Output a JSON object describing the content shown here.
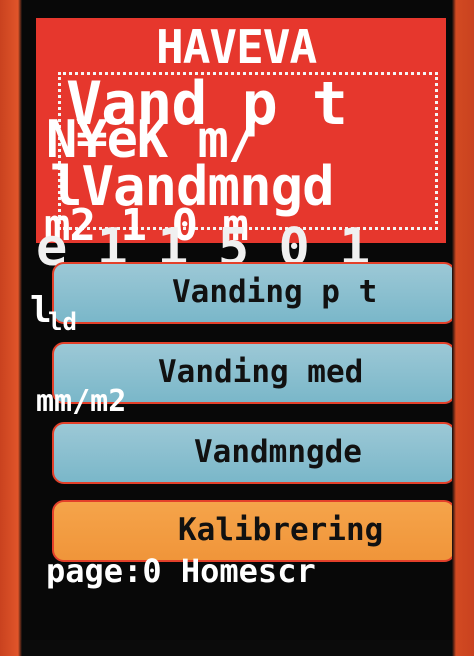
{
  "header": {
    "glitch_title": "HAVEVA",
    "glitch_line1": "Vand p t",
    "glitch_line2": "N¥eK m/",
    "glitch_line3": "lVandmngd",
    "glitch_line4": "m2 1 0 m",
    "glitch_line5": "e 1 1 5 0 1"
  },
  "buttons": [
    {
      "label": "Vanding p t",
      "color": "#8fc1d1"
    },
    {
      "label": "Vanding med",
      "color": "#8fc1d1"
    },
    {
      "label": "Vandmngde",
      "color": "#8fc1d1"
    },
    {
      "label": "Kalibrering",
      "color": "#f39c42"
    }
  ],
  "overlay": {
    "mark": "l",
    "ld": "ld",
    "mm_m2": "mm/m2",
    "page_status": "page:0 Homescr"
  },
  "colors": {
    "header_red": "#e6372d",
    "button_blue": "#8fc1d1",
    "button_orange": "#f39c42",
    "border_red": "#e3402a"
  }
}
